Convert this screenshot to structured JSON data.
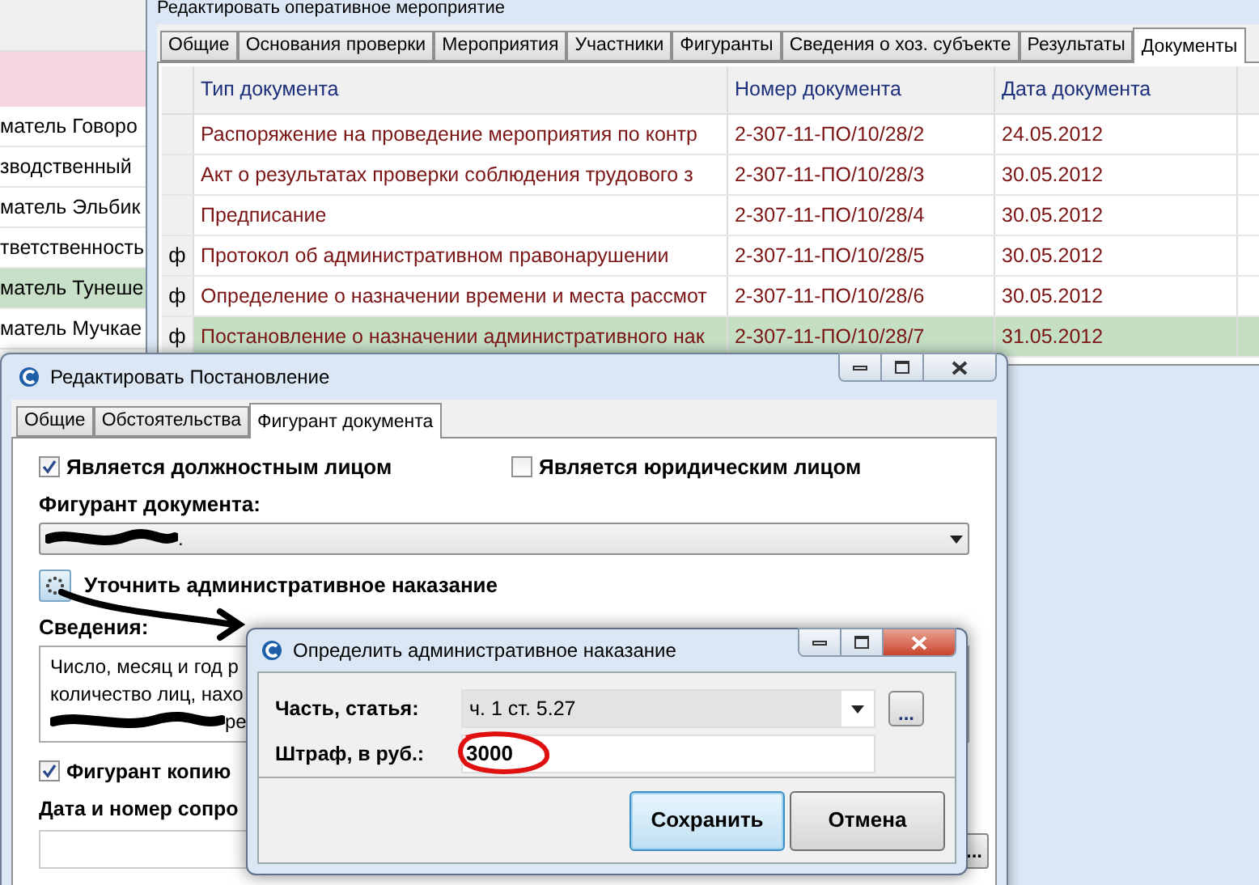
{
  "background_list": {
    "rows": [
      {
        "text": "матель Говоро",
        "selected": false
      },
      {
        "text": "зводственный",
        "selected": false
      },
      {
        "text": "матель Эльбик",
        "selected": false
      },
      {
        "text": "тветственность",
        "selected": false
      },
      {
        "text": "матель Тунеше",
        "selected": true
      },
      {
        "text": "матель Мучкае",
        "selected": false
      }
    ]
  },
  "main_window": {
    "title": "Редактировать оперативное мероприятие",
    "tabs": [
      {
        "label": "Общие",
        "selected": false
      },
      {
        "label": "Основания проверки",
        "selected": false
      },
      {
        "label": "Мероприятия",
        "selected": false
      },
      {
        "label": "Участники",
        "selected": false
      },
      {
        "label": "Фигуранты",
        "selected": false
      },
      {
        "label": "Сведения о хоз. субъекте",
        "selected": false
      },
      {
        "label": "Результаты",
        "selected": false
      },
      {
        "label": "Документы",
        "selected": true
      }
    ],
    "table": {
      "columns": [
        "Тип документа",
        "Номер документа",
        "Дата документа"
      ],
      "rows": [
        {
          "marker": "",
          "cells": [
            "Распоряжение на проведение мероприятия по контр",
            "2-307-11-ПО/10/28/2",
            "24.05.2012"
          ],
          "selected": false
        },
        {
          "marker": "",
          "cells": [
            "Акт о результатах проверки соблюдения трудового з",
            "2-307-11-ПО/10/28/3",
            "30.05.2012"
          ],
          "selected": false
        },
        {
          "marker": "",
          "cells": [
            "Предписание",
            "2-307-11-ПО/10/28/4",
            "30.05.2012"
          ],
          "selected": false
        },
        {
          "marker": "ф",
          "cells": [
            "Протокол об административном правонарушении",
            "2-307-11-ПО/10/28/5",
            "30.05.2012"
          ],
          "selected": false
        },
        {
          "marker": "ф",
          "cells": [
            "Определение о назначении времени и места рассмот",
            "2-307-11-ПО/10/28/6",
            "30.05.2012"
          ],
          "selected": false
        },
        {
          "marker": "ф",
          "cells": [
            "Постановление о назначении административного нак",
            "2-307-11-ПО/10/28/7",
            "31.05.2012"
          ],
          "selected": true
        }
      ]
    }
  },
  "edit_window": {
    "title": "Редактировать Постановление",
    "tabs": [
      {
        "label": "Общие",
        "selected": false
      },
      {
        "label": "Обстоятельства",
        "selected": false
      },
      {
        "label": "Фигурант документа",
        "selected": true
      }
    ],
    "checkboxes": [
      {
        "label": "Является должностным лицом",
        "checked": true
      },
      {
        "label": "Является юридическим лицом",
        "checked": false
      }
    ],
    "figurant_label": "Фигурант документа:",
    "figurant_value": {
      "text": ".",
      "redacted": true
    },
    "refine_label": "Уточнить административное наказание",
    "details_label": "Сведения:",
    "details_lines": [
      {
        "text": "Число, месяц и год р",
        "redacted": false
      },
      {
        "text": "количество лиц, нахо",
        "redacted": false
      },
      {
        "text": "ре",
        "redacted": true
      }
    ],
    "copy_checkbox": {
      "label": "Фигурант копию",
      "checked": true
    },
    "date_label": "Дата и номер сопро",
    "browse_button": "..."
  },
  "dialog": {
    "title": "Определить административное наказание",
    "fields": [
      {
        "kind": "select",
        "label": "Часть, статья:",
        "value": "ч. 1 ст. 5.27",
        "button": "..."
      },
      {
        "kind": "input",
        "label": "Штраф, в руб.:",
        "value": "3000",
        "circled": true
      }
    ],
    "buttons": [
      {
        "label": "Сохранить",
        "default": true
      },
      {
        "label": "Отмена",
        "default": false
      }
    ]
  }
}
